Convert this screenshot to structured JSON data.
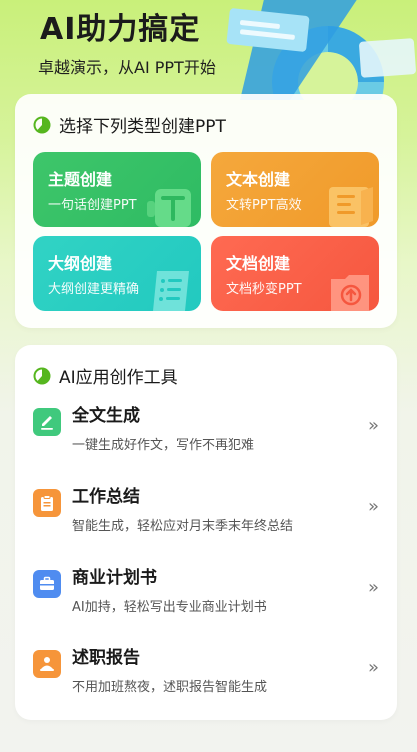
{
  "header": {
    "title": "AI助力搞定",
    "subtitle": "卓越演示，从AI PPT开始"
  },
  "section1": {
    "title": "选择下列类型创建PPT",
    "tiles": [
      {
        "title": "主题创建",
        "subtitle": "一句话创建PPT",
        "color": "#3ec66a",
        "icon": "text-t-icon"
      },
      {
        "title": "文本创建",
        "subtitle": "文转PPT高效",
        "color": "#f5a83c",
        "icon": "document-icon"
      },
      {
        "title": "大纲创建",
        "subtitle": "大纲创建更精确",
        "color": "#31d3c4",
        "icon": "scroll-list-icon"
      },
      {
        "title": "文档创建",
        "subtitle": "文档秒变PPT",
        "color": "#ff6a52",
        "icon": "folder-upload-icon"
      }
    ]
  },
  "section2": {
    "title": "AI应用创作工具",
    "tools": [
      {
        "title": "全文生成",
        "subtitle": "一键生成好作文，写作不再犯难",
        "color": "#40c97d",
        "icon": "pencil-icon"
      },
      {
        "title": "工作总结",
        "subtitle": "智能生成，轻松应对月末季末年终总结",
        "color": "#f6953a",
        "icon": "clipboard-icon"
      },
      {
        "title": "商业计划书",
        "subtitle": "AI加持，轻松写出专业商业计划书",
        "color": "#4f8cf0",
        "icon": "briefcase-icon"
      },
      {
        "title": "述职报告",
        "subtitle": "不用加班熬夜，述职报告智能生成",
        "color": "#f6953a",
        "icon": "presenter-icon"
      }
    ],
    "chevron": "»"
  },
  "colors": {
    "accent_green": "#56b61f"
  }
}
